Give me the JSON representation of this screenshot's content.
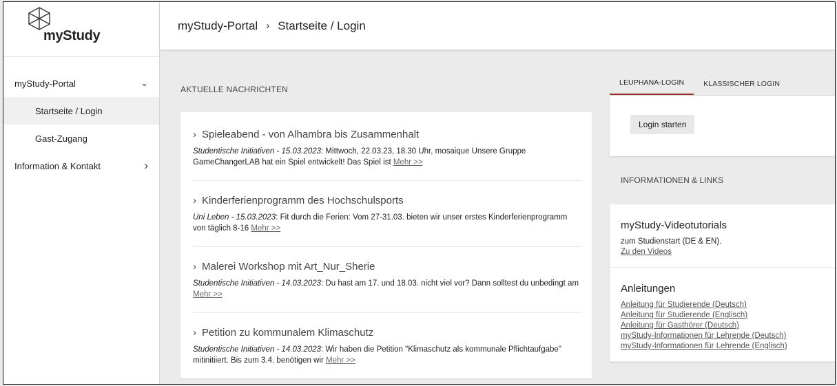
{
  "logo": {
    "text": "myStudy"
  },
  "sidebar": {
    "items": [
      {
        "label": "myStudy-Portal",
        "chevron": "⌄"
      },
      {
        "label": "Startseite / Login"
      },
      {
        "label": "Gast-Zugang"
      },
      {
        "label": "Information & Kontakt",
        "chevron": "›"
      }
    ]
  },
  "header": {
    "crumb1": "myStudy-Portal",
    "sep": "›",
    "crumb2": "Startseite / Login"
  },
  "news": {
    "section_title": "AKTUELLE NACHRICHTEN",
    "items": [
      {
        "title": "Spieleabend - von Alhambra bis Zusammenhalt",
        "meta": "Studentische Initiativen - 15.03.2023",
        "text": ": Mittwoch, 22.03.23, 18.30 Uhr, mosaique Unsere Gruppe GameChangerLAB hat ein Spiel entwickelt! Das Spiel ist ",
        "more": "Mehr >>"
      },
      {
        "title": "Kinderferienprogramm des Hochschulsports",
        "meta": "Uni Leben - 15.03.2023",
        "text": ": Fit durch die Ferien: Vom 27-31.03. bieten wir unser erstes Kinderferienprogramm von täglich 8-16 ",
        "more": "Mehr >>"
      },
      {
        "title": "Malerei Workshop mit Art_Nur_Sherie",
        "meta": "Studentische Initiativen - 14.03.2023",
        "text": ": Du hast am 17. und 18.03. nicht viel vor? Dann solltest du unbedingt am ",
        "more": "Mehr >>"
      },
      {
        "title": "Petition zu kommunalem Klimaschutz",
        "meta": "Studentische Initiativen - 14.03.2023",
        "text": ": Wir haben die Petition \"Klimaschutz als kommunale Pflichtaufgabe\" mitinitiiert. Bis zum 3.4. benötigen wir ",
        "more": "Mehr >>"
      }
    ]
  },
  "login": {
    "tab_active": "LEUPHANA-LOGIN",
    "tab_other": "KLASSISCHER LOGIN",
    "button": "Login starten"
  },
  "info": {
    "section_title": "INFORMATIONEN & LINKS",
    "videos": {
      "title": "myStudy-Videotutorials",
      "text": "zum Studienstart (DE & EN).",
      "link": "Zu den Videos"
    },
    "guides": {
      "title": "Anleitungen",
      "links": [
        "Anleitung für Studierende (Deutsch)",
        "Anleitung für Studierende (Englisch)",
        "Anleitung für Gasthörer (Deutsch)",
        "myStudy-Informationen für Lehrende (Deutsch)",
        "myStudy-Informationen für Lehrende (Englisch)"
      ]
    }
  },
  "colors": {
    "accent": "#9b2d2d",
    "background": "#ebebeb"
  }
}
